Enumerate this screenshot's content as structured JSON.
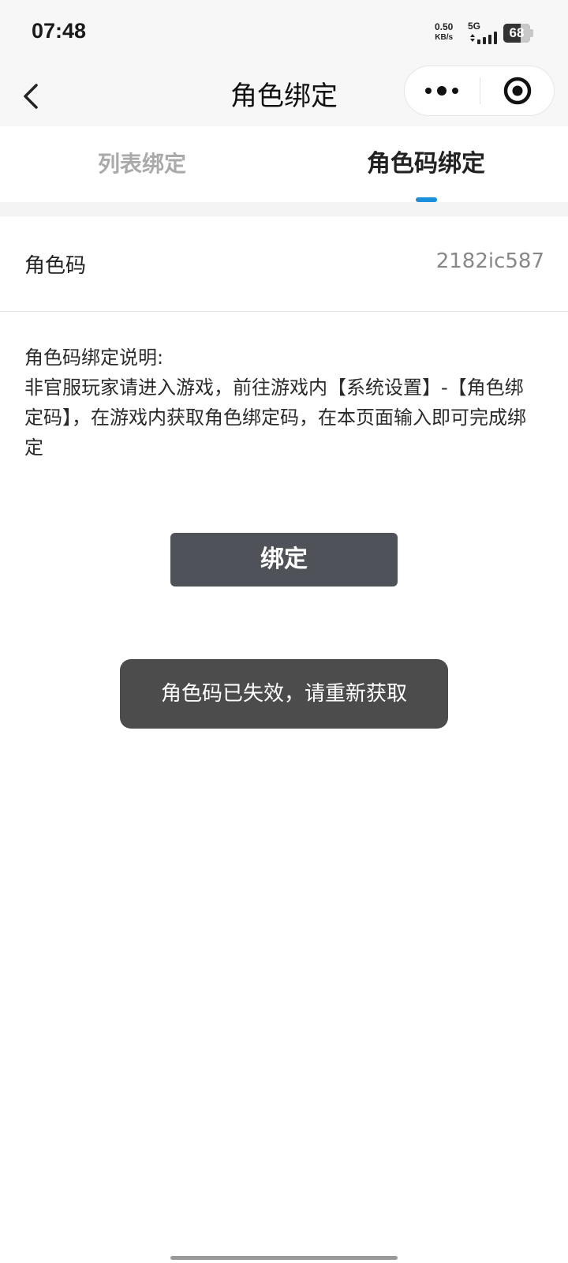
{
  "status_bar": {
    "time": "07:48",
    "net_speed_value": "0.50",
    "net_speed_unit": "KB/s",
    "network_type": "5G",
    "battery_level": "68",
    "battery_fraction": 0.68
  },
  "navbar": {
    "title": "角色绑定",
    "back_icon": "chevron-left-icon",
    "more_icon": "more-dots-icon",
    "close_icon": "target-circle-icon"
  },
  "tabs": [
    {
      "label": "列表绑定",
      "active": false
    },
    {
      "label": "角色码绑定",
      "active": true
    }
  ],
  "role_code": {
    "label": "角色码",
    "value": "2182ic587"
  },
  "instructions": {
    "title": "角色码绑定说明:",
    "body": "非官服玩家请进入游戏，前往游戏内【系统设置】-【角色绑定码】，在游戏内获取角色绑定码，在本页面输入即可完成绑定"
  },
  "bind_button": {
    "label": "绑定"
  },
  "toast": {
    "message": "角色码已失效，请重新获取"
  },
  "colors": {
    "accent": "#1a8fdc",
    "button_bg": "#50525a",
    "toast_bg": "#4c4c4c"
  }
}
